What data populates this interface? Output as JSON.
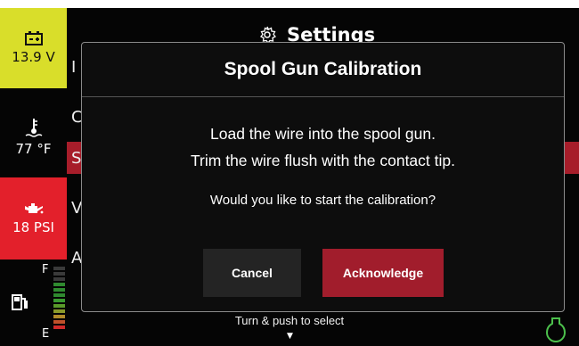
{
  "status": {
    "voltage": "13.9 V",
    "temperature": "77 °F",
    "oil_pressure": "18 PSI",
    "fuel_full": "F",
    "fuel_empty": "E"
  },
  "background": {
    "title": "Settings",
    "footer_hint": "Turn & push to select",
    "row_letters": [
      "I",
      "C",
      "S",
      "V",
      "A"
    ]
  },
  "dialog": {
    "title": "Spool Gun Calibration",
    "line1": "Load the wire into the spool gun.",
    "line2": "Trim the wire flush with the contact tip.",
    "question": "Would you like to start the calibration?",
    "cancel_label": "Cancel",
    "acknowledge_label": "Acknowledge"
  },
  "colors": {
    "voltage_tile": "#d9de2a",
    "oil_tile": "#e3202b",
    "accent_red": "#a11d2c",
    "bulb_green": "#4cc04c"
  }
}
